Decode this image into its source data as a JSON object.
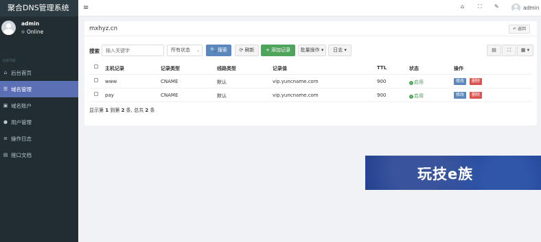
{
  "app": {
    "title": "聚合DNS管理系统"
  },
  "user": {
    "name": "admin",
    "status": "Online"
  },
  "sidebar": {
    "header": "功能导航",
    "items": [
      {
        "label": "后台首页",
        "icon": "home-icon",
        "glyph": "⌂"
      },
      {
        "label": "域名管理",
        "icon": "list-icon",
        "glyph": "☰",
        "active": true
      },
      {
        "label": "域名账户",
        "icon": "lock-icon",
        "glyph": "▣"
      },
      {
        "label": "用户管理",
        "icon": "user-icon",
        "glyph": "●"
      },
      {
        "label": "操作日志",
        "icon": "log-icon",
        "glyph": "≡"
      },
      {
        "label": "接口文档",
        "icon": "doc-icon",
        "glyph": "▤"
      }
    ]
  },
  "topbar": {
    "menu_glyph": "≡",
    "home_glyph": "⌂",
    "fullscreen_glyph": "⛶",
    "settings_glyph": "✎",
    "username": "admin"
  },
  "panel": {
    "domain": "mxhyz.cn",
    "back_label": "↶ 返回"
  },
  "toolbar": {
    "search_label": "搜索",
    "search_placeholder": "输入关键字",
    "status_select": "所有状态",
    "search_button": "🔍 搜索",
    "refresh_button": "⟳ 刷新",
    "add_button": "+ 添加记录",
    "batch_button": "批量操作 ▾",
    "log_button": "日志 ▾",
    "right_icons": [
      "▤",
      "⛶",
      "▦ ▾"
    ]
  },
  "table": {
    "columns": [
      "主机记录",
      "记录类型",
      "线路类型",
      "记录值",
      "TTL",
      "状态",
      "操作"
    ],
    "rows": [
      {
        "host": "www",
        "type": "CNAME",
        "line": "默认",
        "value": "vip.yuncname.com",
        "ttl": "900",
        "status": "启用"
      },
      {
        "host": "pay",
        "type": "CNAME",
        "line": "默认",
        "value": "vip.yuncname.com",
        "ttl": "900",
        "status": "启用"
      }
    ],
    "edit_label": "修改",
    "delete_label": "删除"
  },
  "pagination": {
    "prefix": "显示第 ",
    "from": "1",
    "mid1": " 到第 ",
    "to": "2",
    "mid2": " 条, 总共 ",
    "total": "2",
    "suffix": " 条"
  },
  "watermark": {
    "text": "玩技e族"
  },
  "colors": {
    "sidebar_bg": "#222d32",
    "active_item": "#5b6fb5",
    "primary": "#5b87bc",
    "success": "#4fa45c",
    "danger": "#d9534f"
  }
}
